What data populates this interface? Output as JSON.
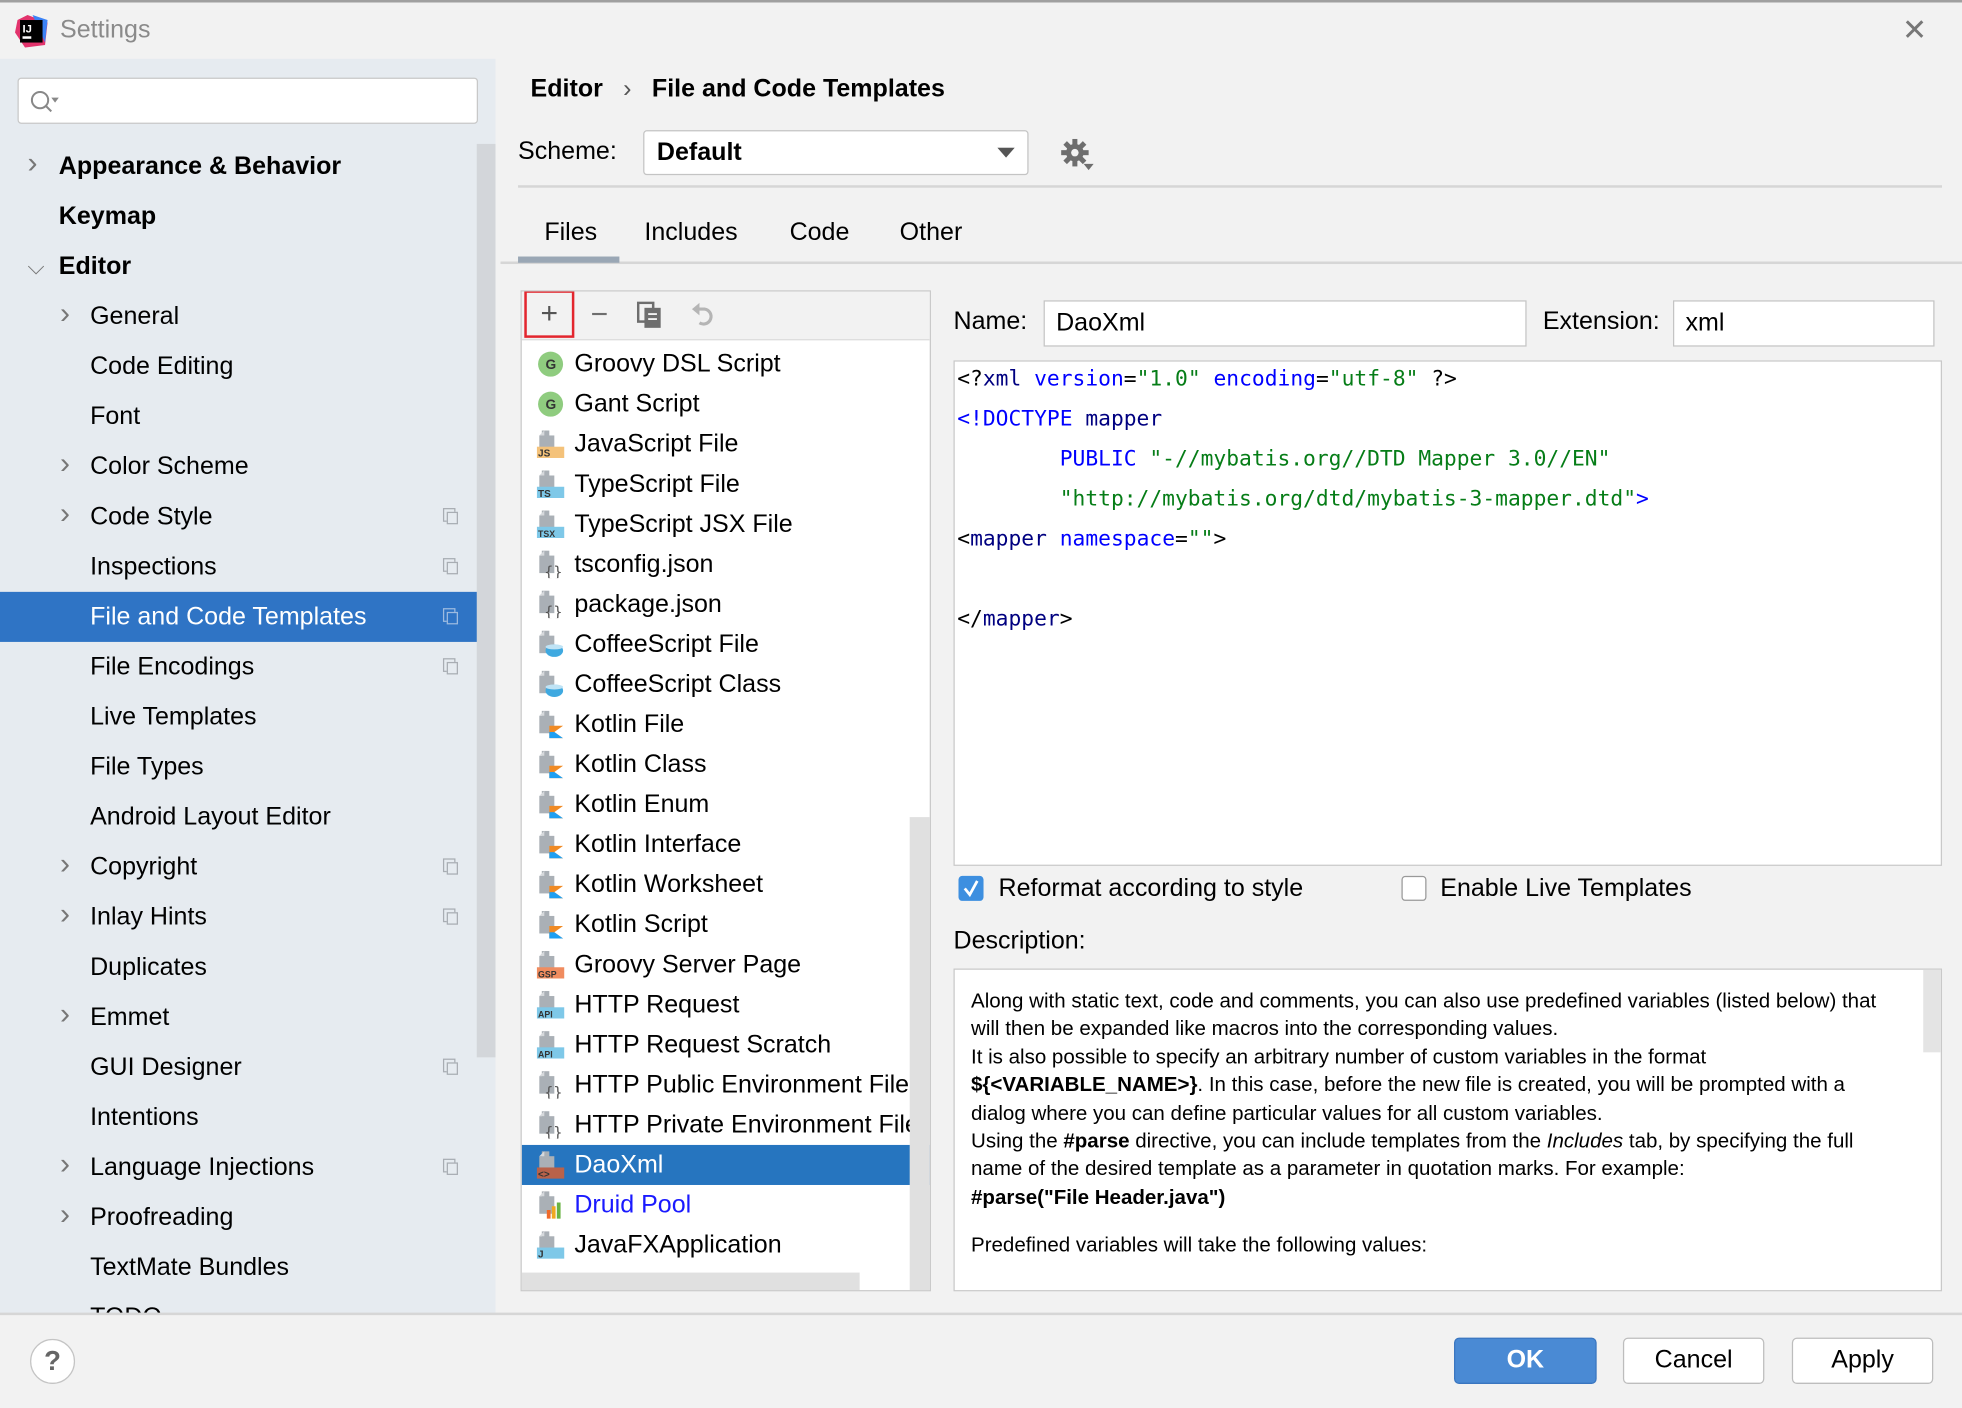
{
  "window": {
    "title": "Settings",
    "close_icon": "close-icon",
    "accent": "#2f74c5"
  },
  "sidebar": {
    "search_placeholder": "",
    "items": [
      {
        "label": "Appearance & Behavior",
        "level": 0,
        "expandable": true,
        "expanded": false,
        "bold": true
      },
      {
        "label": "Keymap",
        "level": 0,
        "expandable": false,
        "bold": true
      },
      {
        "label": "Editor",
        "level": 0,
        "expandable": true,
        "expanded": true,
        "bold": true
      },
      {
        "label": "General",
        "level": 1,
        "expandable": true
      },
      {
        "label": "Code Editing",
        "level": 1
      },
      {
        "label": "Font",
        "level": 1
      },
      {
        "label": "Color Scheme",
        "level": 1,
        "expandable": true
      },
      {
        "label": "Code Style",
        "level": 1,
        "expandable": true,
        "project": true
      },
      {
        "label": "Inspections",
        "level": 1,
        "project": true
      },
      {
        "label": "File and Code Templates",
        "level": 1,
        "project": true,
        "selected": true
      },
      {
        "label": "File Encodings",
        "level": 1,
        "project": true
      },
      {
        "label": "Live Templates",
        "level": 1
      },
      {
        "label": "File Types",
        "level": 1
      },
      {
        "label": "Android Layout Editor",
        "level": 1
      },
      {
        "label": "Copyright",
        "level": 1,
        "expandable": true,
        "project": true
      },
      {
        "label": "Inlay Hints",
        "level": 1,
        "expandable": true,
        "project": true
      },
      {
        "label": "Duplicates",
        "level": 1
      },
      {
        "label": "Emmet",
        "level": 1,
        "expandable": true
      },
      {
        "label": "GUI Designer",
        "level": 1,
        "project": true
      },
      {
        "label": "Intentions",
        "level": 1
      },
      {
        "label": "Language Injections",
        "level": 1,
        "expandable": true,
        "project": true
      },
      {
        "label": "Proofreading",
        "level": 1,
        "expandable": true
      },
      {
        "label": "TextMate Bundles",
        "level": 1
      },
      {
        "label": "TODO",
        "level": 1
      }
    ]
  },
  "breadcrumb": {
    "parent": "Editor",
    "separator": "›",
    "current": "File and Code Templates"
  },
  "scheme": {
    "label": "Scheme:",
    "value": "Default"
  },
  "tabs": [
    {
      "label": "Files",
      "active": true
    },
    {
      "label": "Includes"
    },
    {
      "label": "Code"
    },
    {
      "label": "Other"
    }
  ],
  "toolbar": {
    "add": "+",
    "remove": "−"
  },
  "files": [
    {
      "label": "Groovy DSL Script",
      "icon": "groovy",
      "badge": "G"
    },
    {
      "label": "Gant Script",
      "icon": "groovy",
      "badge": "G"
    },
    {
      "label": "JavaScript File",
      "icon": "badge",
      "badge": "JS",
      "color": "#f4c27a"
    },
    {
      "label": "TypeScript File",
      "icon": "badge",
      "badge": "TS",
      "color": "#7ec8e8"
    },
    {
      "label": "TypeScript JSX File",
      "icon": "badge",
      "badge": "TSX",
      "color": "#7ec8e8"
    },
    {
      "label": "tsconfig.json",
      "icon": "json"
    },
    {
      "label": "package.json",
      "icon": "json"
    },
    {
      "label": "CoffeeScript File",
      "icon": "coffee"
    },
    {
      "label": "CoffeeScript Class",
      "icon": "coffee"
    },
    {
      "label": "Kotlin File",
      "icon": "kotlin"
    },
    {
      "label": "Kotlin Class",
      "icon": "kotlin"
    },
    {
      "label": "Kotlin Enum",
      "icon": "kotlin"
    },
    {
      "label": "Kotlin Interface",
      "icon": "kotlin"
    },
    {
      "label": "Kotlin Worksheet",
      "icon": "kotlin"
    },
    {
      "label": "Kotlin Script",
      "icon": "kotlin"
    },
    {
      "label": "Groovy Server Page",
      "icon": "badge",
      "badge": "GSP",
      "color": "#f08c5f"
    },
    {
      "label": "HTTP Request",
      "icon": "badge",
      "badge": "API",
      "color": "#7ec8e8"
    },
    {
      "label": "HTTP Request Scratch",
      "icon": "badge",
      "badge": "API",
      "color": "#7ec8e8"
    },
    {
      "label": "HTTP Public Environment File",
      "icon": "json"
    },
    {
      "label": "HTTP Private Environment File",
      "icon": "json"
    },
    {
      "label": "DaoXml",
      "icon": "badge",
      "badge": "<>",
      "color": "#b9624a",
      "selected": true
    },
    {
      "label": "Druid Pool",
      "icon": "chart",
      "link": true
    },
    {
      "label": "JavaFXApplication",
      "icon": "badge",
      "badge": "J",
      "color": "#7ec8e8"
    }
  ],
  "form": {
    "name_label": "Name:",
    "name_value": "DaoXml",
    "ext_label": "Extension:",
    "ext_value": "xml"
  },
  "code_lines": [
    [
      {
        "c": "p",
        "t": "<?"
      },
      {
        "c": "t",
        "t": "xml "
      },
      {
        "c": "a",
        "t": "version"
      },
      {
        "c": "p",
        "t": "="
      },
      {
        "c": "s",
        "t": "\"1.0\""
      },
      {
        "c": "p",
        "t": " "
      },
      {
        "c": "a",
        "t": "encoding"
      },
      {
        "c": "p",
        "t": "="
      },
      {
        "c": "s",
        "t": "\"utf-8\""
      },
      {
        "c": "p",
        "t": " ?>"
      }
    ],
    [
      {
        "c": "a",
        "t": "<!DOCTYPE "
      },
      {
        "c": "t",
        "t": "mapper"
      }
    ],
    [
      {
        "c": "p",
        "t": "        "
      },
      {
        "c": "a",
        "t": "PUBLIC "
      },
      {
        "c": "s",
        "t": "\"-//mybatis.org//DTD Mapper 3.0//EN\""
      }
    ],
    [
      {
        "c": "p",
        "t": "        "
      },
      {
        "c": "s",
        "t": "\"http://mybatis.org/dtd/mybatis-3-mapper.dtd\""
      },
      {
        "c": "a",
        "t": ">"
      }
    ],
    [
      {
        "c": "p",
        "t": "<"
      },
      {
        "c": "t",
        "t": "mapper "
      },
      {
        "c": "a",
        "t": "namespace"
      },
      {
        "c": "p",
        "t": "="
      },
      {
        "c": "s",
        "t": "\"\""
      },
      {
        "c": "p",
        "t": ">"
      }
    ],
    [],
    [
      {
        "c": "p",
        "t": "</"
      },
      {
        "c": "t",
        "t": "mapper"
      },
      {
        "c": "p",
        "t": ">"
      }
    ]
  ],
  "options": {
    "reformat_label": "Reformat according to style",
    "reformat_checked": true,
    "live_label": "Enable Live Templates",
    "live_checked": false
  },
  "description": {
    "label": "Description:",
    "p1": "Along with static text, code and comments, you can also use predefined variables (listed below) that will then be expanded like macros into the corresponding values.",
    "p2a": "It is also possible to specify an arbitrary number of custom variables in the format ",
    "p2b": "${<VARIABLE_NAME>}",
    "p2c": ". In this case, before the new file is created, you will be prompted with a dialog where you can define particular values for all custom variables.",
    "p3a": "Using the ",
    "p3b": "#parse",
    "p3c": " directive, you can include templates from the ",
    "p3d": "Includes",
    "p3e": " tab, by specifying the full name of the desired template as a parameter in quotation marks. For example:",
    "p4": "#parse(\"File Header.java\")",
    "p5": "Predefined variables will take the following values:"
  },
  "footer": {
    "help": "?",
    "ok": "OK",
    "cancel": "Cancel",
    "apply": "Apply"
  }
}
